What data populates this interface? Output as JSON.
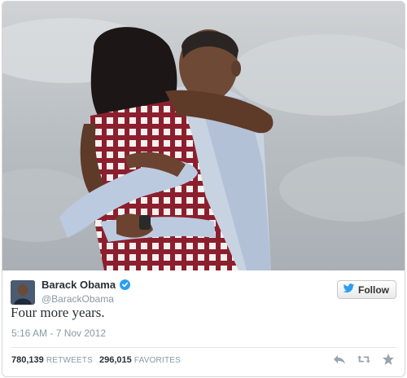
{
  "author": {
    "display_name": "Barack Obama",
    "handle": "@BarackObama",
    "verified": true
  },
  "follow_button": {
    "label": "Follow",
    "icon": "twitter-bird-icon"
  },
  "tweet": {
    "text": "Four more years.",
    "timestamp": "5:16 AM - 7 Nov 2012"
  },
  "stats": {
    "retweets_count": "780,139",
    "retweets_label": "RETWEETS",
    "favorites_count": "296,015",
    "favorites_label": "FAVORITES"
  },
  "actions": [
    "reply-icon",
    "retweet-icon",
    "favorite-star-icon"
  ],
  "colors": {
    "verified_badge": "#2b9ff2",
    "follow_bird": "#2b9ff2",
    "text_primary": "#292f33",
    "text_secondary": "#8899a6"
  }
}
